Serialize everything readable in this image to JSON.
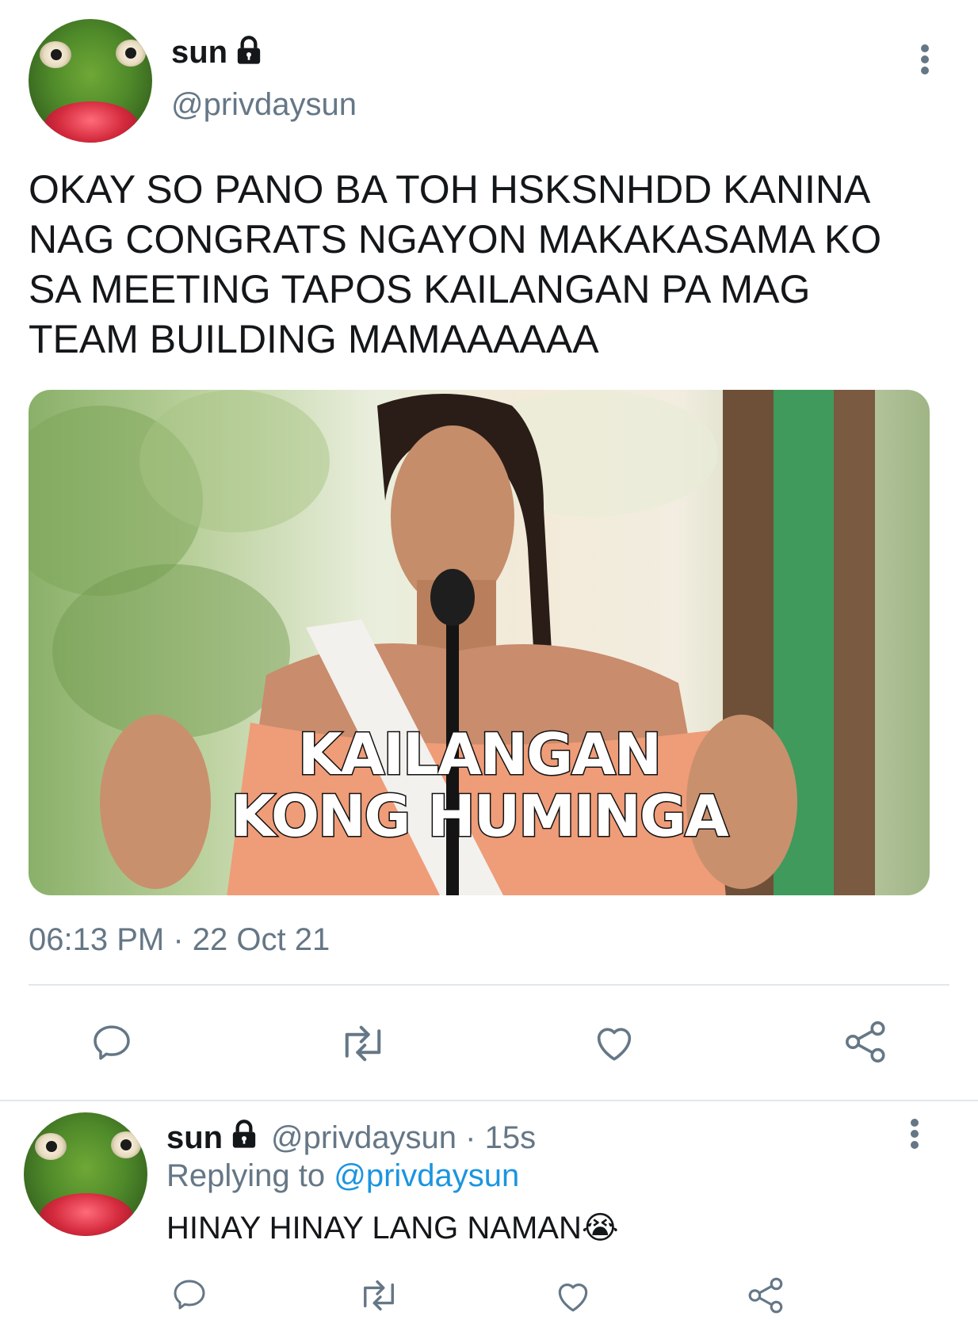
{
  "tweet": {
    "author_name": "sun",
    "author_handle": "@privdaysun",
    "text_lines": [
      "OKAY SO PANO BA TOH HSKSNHDD KANINA",
      "NAG CONGRATS NGAYON MAKAKASAMA KO",
      "SA MEETING TAPOS KAILANGAN PA MAG",
      "TEAM BUILDING MAMAAAAAA"
    ],
    "media_caption_line1": "KAILANGAN",
    "media_caption_line2": "KONG HUMINGA",
    "timestamp": "06:13 PM · 22 Oct 21"
  },
  "reply": {
    "author_name": "sun",
    "author_handle": "@privdaysun · 15s",
    "replying_to_label": "Replying to ",
    "replying_to_handle": "@privdaysun",
    "text": "HINAY HINAY LANG NAMAN😭"
  },
  "icons": [
    "lock-icon",
    "more-options-icon",
    "reply-icon",
    "retweet-icon",
    "like-icon",
    "share-icon"
  ],
  "colors": {
    "text_primary": "#14171a",
    "text_secondary": "#657786",
    "link": "#1b95e0",
    "divider": "#e1e8ed"
  }
}
